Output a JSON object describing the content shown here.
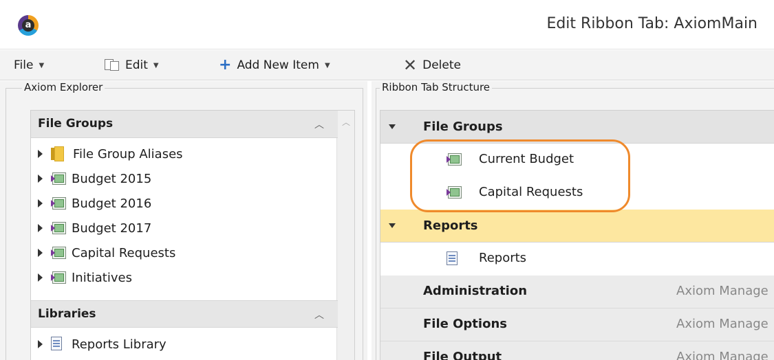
{
  "window": {
    "title": "Edit Ribbon Tab: AxiomMain",
    "logo_letter": "a"
  },
  "toolbar": {
    "file_label": "File",
    "edit_label": "Edit",
    "add_label": "Add New Item",
    "delete_label": "Delete"
  },
  "explorer": {
    "title": "Axiom Explorer",
    "file_groups": {
      "title": "File Groups",
      "items": [
        {
          "label": "File Group Aliases",
          "icon": "folder-icon"
        },
        {
          "label": "Budget 2015",
          "icon": "file-group-icon"
        },
        {
          "label": "Budget 2016",
          "icon": "file-group-icon"
        },
        {
          "label": "Budget 2017",
          "icon": "file-group-icon"
        },
        {
          "label": "Capital Requests",
          "icon": "file-group-icon"
        },
        {
          "label": "Initiatives",
          "icon": "file-group-icon"
        }
      ]
    },
    "libraries": {
      "title": "Libraries",
      "items": [
        {
          "label": "Reports Library",
          "icon": "report-icon"
        }
      ]
    }
  },
  "structure": {
    "title": "Ribbon Tab Structure",
    "file_groups": {
      "label": "File Groups",
      "children": [
        "Current Budget",
        "Capital Requests"
      ]
    },
    "reports": {
      "label": "Reports",
      "children": [
        "Reports"
      ]
    },
    "other_rows": [
      {
        "label": "Administration",
        "desc": "Axiom Manage"
      },
      {
        "label": "File Options",
        "desc": "Axiom Manage"
      },
      {
        "label": "File Output",
        "desc": "Axiom Manage"
      }
    ]
  },
  "colors": {
    "highlight": "#ef8a2c",
    "selected_row": "#fde7a0",
    "accent": "#2c6fc5"
  }
}
